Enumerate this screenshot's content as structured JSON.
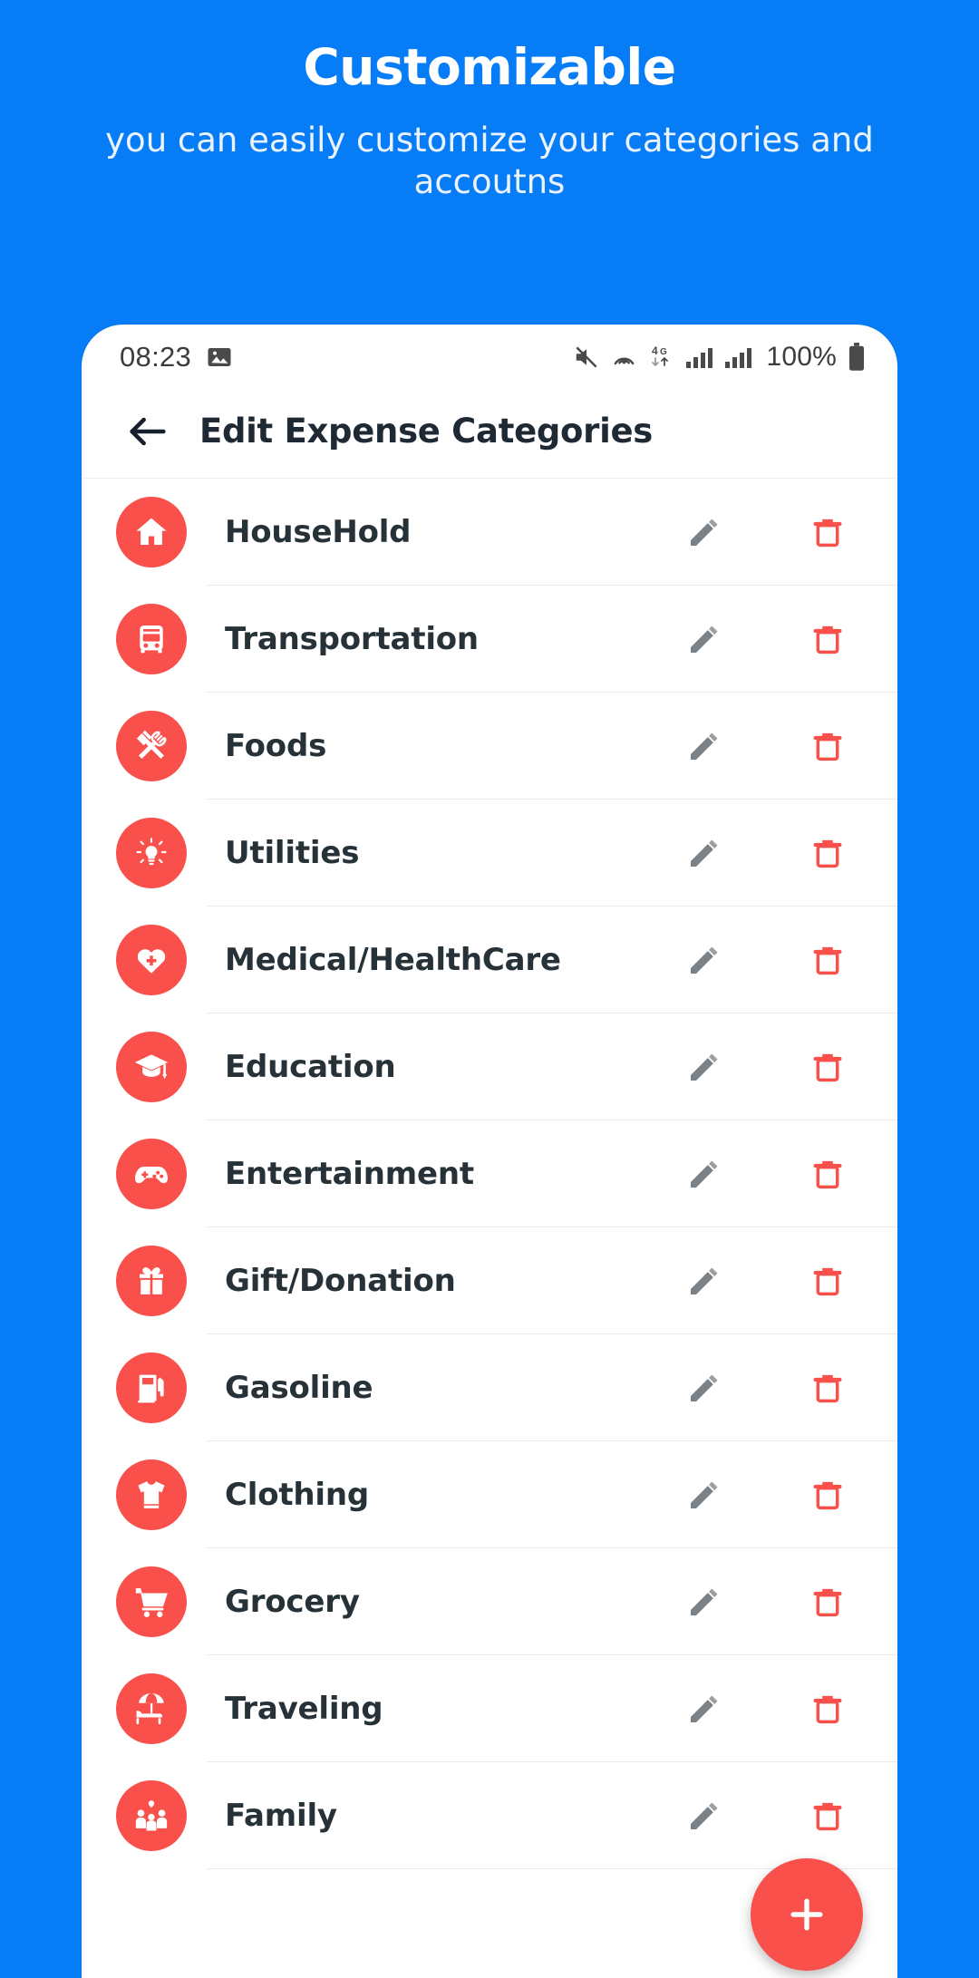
{
  "promo": {
    "title": "Customizable",
    "subtitle": "you can easily customize your categories and accoutns",
    "background_color": "#067DF7"
  },
  "statusbar": {
    "time": "08:23",
    "battery_percent": "100%",
    "icons": [
      "image-icon",
      "mute-icon",
      "hotspot-icon",
      "network-4g-icon",
      "signal-bars-icon",
      "signal-bars-icon",
      "battery-full-icon"
    ]
  },
  "appbar": {
    "back_icon": "arrow-left-icon",
    "title": "Edit Expense Categories"
  },
  "actions": {
    "edit_icon": "pencil-icon",
    "delete_icon": "trash-icon",
    "add_icon": "plus-icon",
    "edit_color": "#7B8287",
    "delete_color": "#F9504B",
    "accent_color": "#F9504B"
  },
  "categories": [
    {
      "label": "HouseHold",
      "icon": "home-icon"
    },
    {
      "label": "Transportation",
      "icon": "bus-icon"
    },
    {
      "label": "Foods",
      "icon": "cutlery-icon"
    },
    {
      "label": "Utilities",
      "icon": "lightbulb-icon"
    },
    {
      "label": "Medical/HealthCare",
      "icon": "heart-plus-icon"
    },
    {
      "label": "Education",
      "icon": "graduation-cap-icon"
    },
    {
      "label": "Entertainment",
      "icon": "gamepad-icon"
    },
    {
      "label": "Gift/Donation",
      "icon": "gift-icon"
    },
    {
      "label": "Gasoline",
      "icon": "gas-pump-icon"
    },
    {
      "label": "Clothing",
      "icon": "tshirt-icon"
    },
    {
      "label": "Grocery",
      "icon": "shopping-cart-icon"
    },
    {
      "label": "Traveling",
      "icon": "beach-umbrella-icon"
    },
    {
      "label": "Family",
      "icon": "family-icon"
    }
  ]
}
